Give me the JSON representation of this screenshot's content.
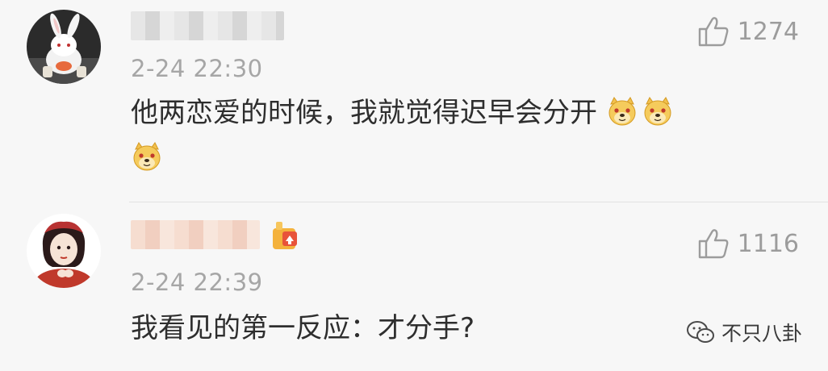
{
  "comments": [
    {
      "username": "",
      "timestamp": "2-24 22:30",
      "likes": "1274",
      "text": "他两恋爱的时候，我就觉得迟早会分开",
      "emoji": "doge-emoji"
    },
    {
      "username": "",
      "timestamp": "2-24 22:39",
      "likes": "1116",
      "text": "我看见的第一反应：才分手?"
    }
  ],
  "watermark": {
    "label": "不只八卦"
  },
  "colors": {
    "background": "#f7f7f7",
    "meta_text": "#a6a6a6",
    "body_text": "#2e2e2e",
    "like_icon": "#9c9c9c"
  }
}
